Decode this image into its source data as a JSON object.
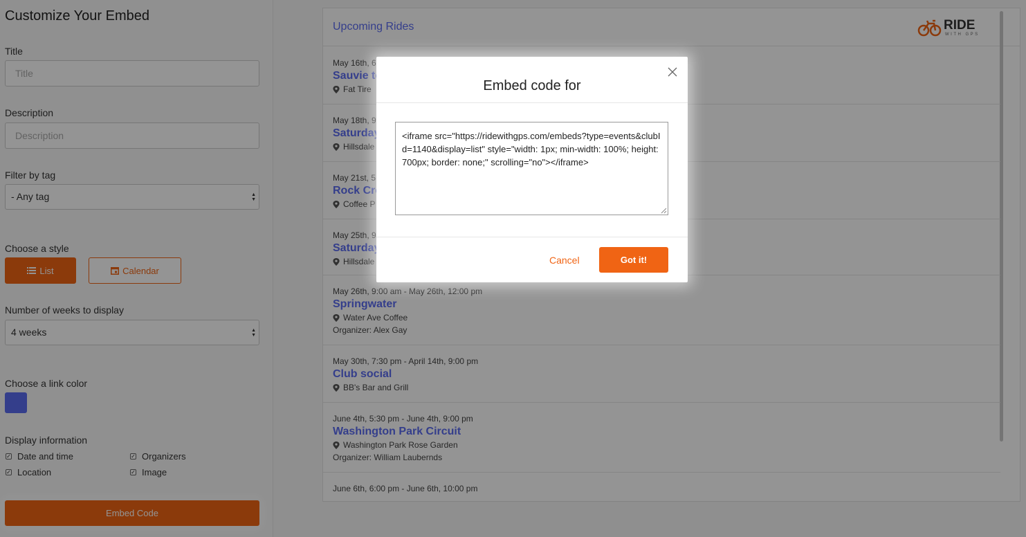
{
  "left": {
    "heading": "Customize Your Embed",
    "title_label": "Title",
    "title_placeholder": "Title",
    "description_label": "Description",
    "description_placeholder": "Description",
    "filter_label": "Filter by tag",
    "filter_value": "- Any tag",
    "style_label": "Choose a style",
    "style_list": "List",
    "style_calendar": "Calendar",
    "weeks_label": "Number of weeks to display",
    "weeks_value": "4 weeks",
    "color_label": "Choose a link color",
    "link_color": "#5b6bf0",
    "display_label": "Display information",
    "checks": {
      "date_time": "Date and time",
      "organizers": "Organizers",
      "location": "Location",
      "image": "Image"
    },
    "embed_button": "Embed Code"
  },
  "preview": {
    "title": "Upcoming Rides",
    "logo_text": "RIDE",
    "logo_subtext": "WITH GPS",
    "events": [
      {
        "date": "May 16th, 6",
        "name": "Sauvie to",
        "location": "Fat Tire",
        "organizer": ""
      },
      {
        "date": "May 18th, 9",
        "name": "Saturday",
        "location": "Hillsdale",
        "organizer": ""
      },
      {
        "date": "May 21st, 5",
        "name": "Rock Cre",
        "location": "Coffee P",
        "organizer": ""
      },
      {
        "date": "May 25th, 9",
        "name": "Saturday",
        "location": "Hillsdale",
        "organizer": ""
      },
      {
        "date": "May 26th, 9:00 am - May 26th, 12:00 pm",
        "name": "Springwater",
        "location": "Water Ave Coffee",
        "organizer": "Organizer: Alex Gay"
      },
      {
        "date": "May 30th, 7:30 pm - April 14th, 9:00 pm",
        "name": "Club social",
        "location": "BB's Bar and Grill",
        "organizer": ""
      },
      {
        "date": "June 4th, 5:30 pm - June 4th, 9:00 pm",
        "name": "Washington Park Circuit",
        "location": "Washington Park Rose Garden",
        "organizer": "Organizer: William Laubernds"
      },
      {
        "date": "June 6th, 6:00 pm - June 6th, 10:00 pm",
        "name": "",
        "location": "",
        "organizer": ""
      }
    ]
  },
  "modal": {
    "title": "Embed code for",
    "code": "<iframe src=\"https://ridewithgps.com/embeds?type=events&clubId=1140&display=list\" style=\"width: 1px; min-width: 100%; height: 700px; border: none;\" scrolling=\"no\"></iframe>",
    "cancel": "Cancel",
    "confirm": "Got it!"
  },
  "colors": {
    "accent": "#f06414",
    "link": "#5b6bf0"
  }
}
